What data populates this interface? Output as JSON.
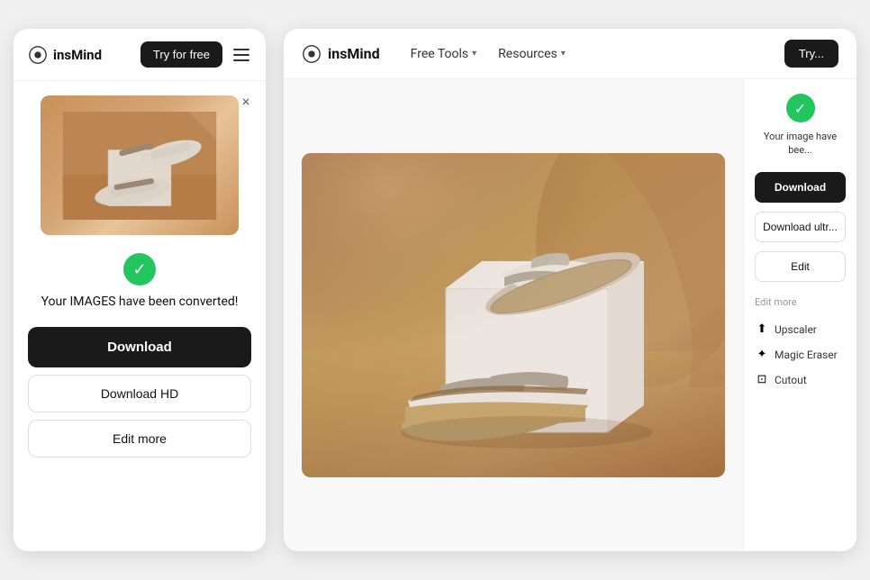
{
  "brand": {
    "name": "insMind",
    "logo_alt": "insMind logo"
  },
  "mobile": {
    "try_free_label": "Try for free",
    "close_icon": "×",
    "success_check": "✓",
    "success_message": "Your IMAGES have been converted!",
    "download_label": "Download",
    "download_hd_label": "Download HD",
    "edit_more_label": "Edit more"
  },
  "desktop": {
    "try_free_label": "Try...",
    "nav": [
      {
        "label": "Free Tools",
        "has_dropdown": true
      },
      {
        "label": "Resources",
        "has_dropdown": true
      }
    ],
    "sidebar": {
      "success_text": "Your image have bee...",
      "download_label": "Download",
      "download_ultra_label": "Download ultr...",
      "edit_label": "Edit",
      "edit_more_label": "Edit more",
      "tools": [
        {
          "label": "Upscaler",
          "icon": "⬆"
        },
        {
          "label": "Magic Eraser",
          "icon": "✦"
        },
        {
          "label": "Cutout",
          "icon": "⊡"
        }
      ]
    }
  }
}
